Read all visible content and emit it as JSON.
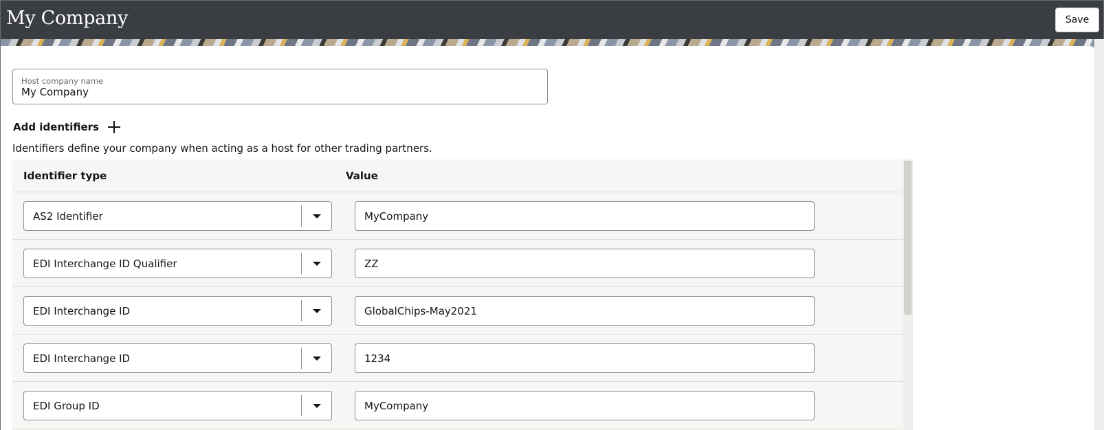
{
  "header": {
    "title": "My Company",
    "save_label": "Save"
  },
  "host": {
    "label": "Host company name",
    "value": "My Company"
  },
  "identifiers": {
    "add_label": "Add identifiers",
    "description": "Identifiers define your company when acting as a host for other trading partners.",
    "columns": [
      "Identifier type",
      "Value"
    ],
    "rows": [
      {
        "type": "AS2 Identifier",
        "value": "MyCompany"
      },
      {
        "type": "EDI Interchange ID Qualifier",
        "value": "ZZ"
      },
      {
        "type": "EDI Interchange ID",
        "value": "GlobalChips-May2021"
      },
      {
        "type": "EDI Interchange ID",
        "value": "1234"
      },
      {
        "type": "EDI Group ID",
        "value": "MyCompany"
      }
    ]
  }
}
